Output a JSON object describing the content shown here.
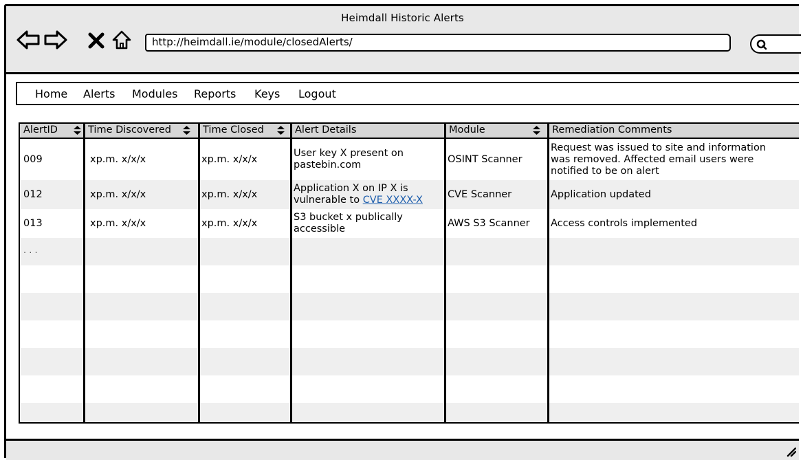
{
  "window": {
    "title": "Heimdall Historic Alerts"
  },
  "toolbar": {
    "back_icon": "back-arrow-icon",
    "forward_icon": "forward-arrow-icon",
    "stop_icon": "close-icon",
    "home_icon": "home-icon",
    "address_value": "http://heimdall.ie/module/closedAlerts/",
    "search_icon": "search-icon"
  },
  "menu": {
    "items": [
      {
        "label": "Home"
      },
      {
        "label": "Alerts"
      },
      {
        "label": "Modules"
      },
      {
        "label": "Reports"
      },
      {
        "label": "Keys"
      },
      {
        "label": "Logout"
      }
    ]
  },
  "table": {
    "columns": [
      {
        "label": "AlertID",
        "sortable": true
      },
      {
        "label": "Time Discovered",
        "sortable": true
      },
      {
        "label": "Time Closed",
        "sortable": true
      },
      {
        "label": "Alert Details",
        "sortable": false
      },
      {
        "label": "Module",
        "sortable": true
      },
      {
        "label": "Remediation Comments",
        "sortable": false
      }
    ],
    "rows": [
      {
        "id": "009",
        "time_discovered": "xp.m. x/x/x",
        "time_closed": "xp.m. x/x/x",
        "details": "User key X present on pastebin.com",
        "details_link": "",
        "module": "OSINT Scanner",
        "comments": "Request was issued to site and information was removed. Affected email users were notified to be on alert"
      },
      {
        "id": "012",
        "time_discovered": "xp.m. x/x/x",
        "time_closed": "xp.m. x/x/x",
        "details": "Application X on IP X is vulnerable to",
        "details_link": "CVE XXXX-X",
        "module": "CVE Scanner",
        "comments": "Application updated"
      },
      {
        "id": "013",
        "time_discovered": "xp.m. x/x/x",
        "time_closed": "xp.m. x/x/x",
        "details": "S3 bucket x publically accessible",
        "details_link": "",
        "module": "AWS S3 Scanner",
        "comments": "Access controls implemented"
      }
    ],
    "more_indicator": ". . ."
  },
  "statusbar": {
    "grip_icon": "resize-grip-icon"
  }
}
